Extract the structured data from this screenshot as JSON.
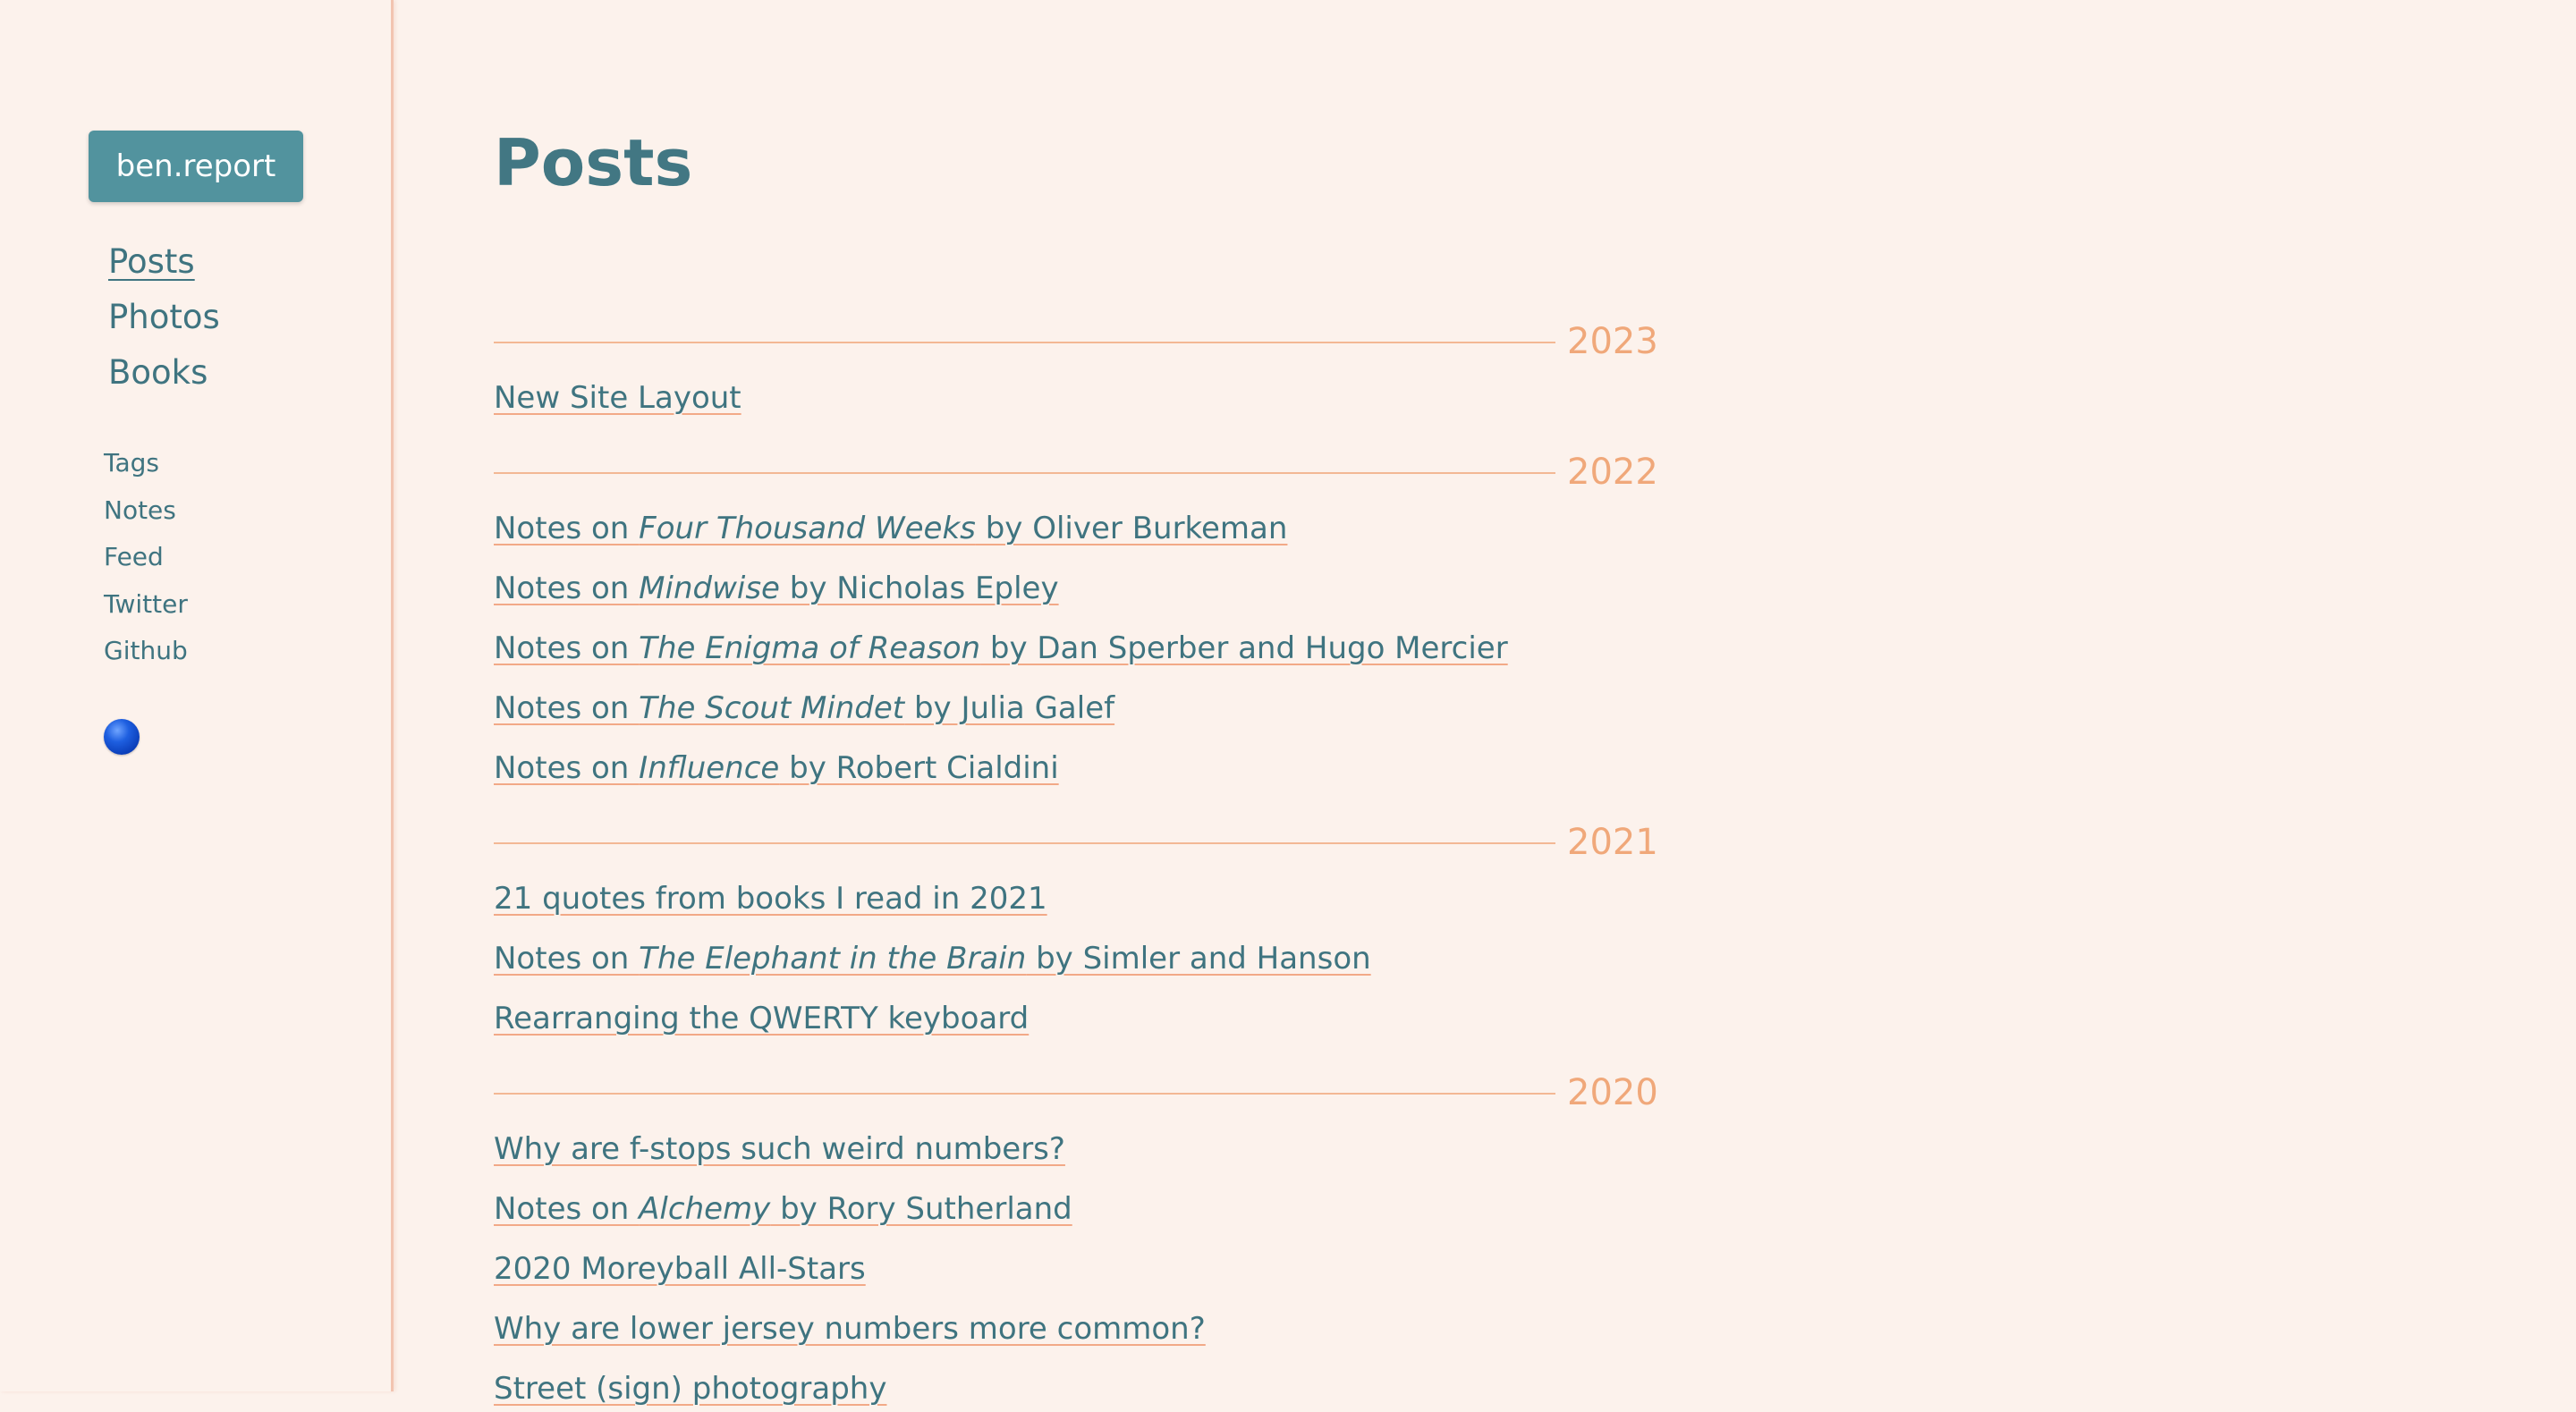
{
  "sidebar": {
    "brand": "ben.report",
    "primary_nav": [
      {
        "label": "Posts",
        "active": true
      },
      {
        "label": "Photos",
        "active": false
      },
      {
        "label": "Books",
        "active": false
      }
    ],
    "secondary_nav": [
      "Tags",
      "Notes",
      "Feed",
      "Twitter",
      "Github"
    ],
    "theme_toggle_icon": "blue-circle-icon"
  },
  "main": {
    "title": "Posts",
    "years": [
      {
        "year": "2023",
        "posts": [
          {
            "parts": [
              {
                "text": "New Site Layout"
              }
            ]
          }
        ]
      },
      {
        "year": "2022",
        "posts": [
          {
            "parts": [
              {
                "text": "Notes on "
              },
              {
                "text": "Four Thousand Weeks",
                "italic": true
              },
              {
                "text": " by Oliver Burkeman"
              }
            ]
          },
          {
            "parts": [
              {
                "text": "Notes on "
              },
              {
                "text": "Mindwise",
                "italic": true
              },
              {
                "text": " by Nicholas Epley"
              }
            ]
          },
          {
            "parts": [
              {
                "text": "Notes on "
              },
              {
                "text": "The Enigma of Reason",
                "italic": true
              },
              {
                "text": " by Dan Sperber and Hugo Mercier"
              }
            ]
          },
          {
            "parts": [
              {
                "text": "Notes on "
              },
              {
                "text": "The Scout Mindet",
                "italic": true
              },
              {
                "text": " by Julia Galef"
              }
            ]
          },
          {
            "parts": [
              {
                "text": "Notes on "
              },
              {
                "text": "Influence",
                "italic": true
              },
              {
                "text": " by Robert Cialdini"
              }
            ]
          }
        ]
      },
      {
        "year": "2021",
        "posts": [
          {
            "parts": [
              {
                "text": "21 quotes from books I read in 2021"
              }
            ]
          },
          {
            "parts": [
              {
                "text": "Notes on "
              },
              {
                "text": "The Elephant in the Brain",
                "italic": true
              },
              {
                "text": " by Simler and Hanson"
              }
            ]
          },
          {
            "parts": [
              {
                "text": "Rearranging the QWERTY keyboard"
              }
            ]
          }
        ]
      },
      {
        "year": "2020",
        "posts": [
          {
            "parts": [
              {
                "text": "Why are f-stops such weird numbers?"
              }
            ]
          },
          {
            "parts": [
              {
                "text": "Notes on "
              },
              {
                "text": "Alchemy",
                "italic": true
              },
              {
                "text": " by Rory Sutherland"
              }
            ]
          },
          {
            "parts": [
              {
                "text": "2020 Moreyball All-Stars"
              }
            ]
          },
          {
            "parts": [
              {
                "text": "Why are lower jersey numbers more common?"
              }
            ]
          },
          {
            "parts": [
              {
                "text": "Street (sign) photography"
              }
            ]
          }
        ]
      }
    ]
  },
  "colors": {
    "background": "#fcf2ec",
    "accent": "#52939e",
    "text": "#3f7480",
    "year_and_rule": "#f0a87a"
  }
}
